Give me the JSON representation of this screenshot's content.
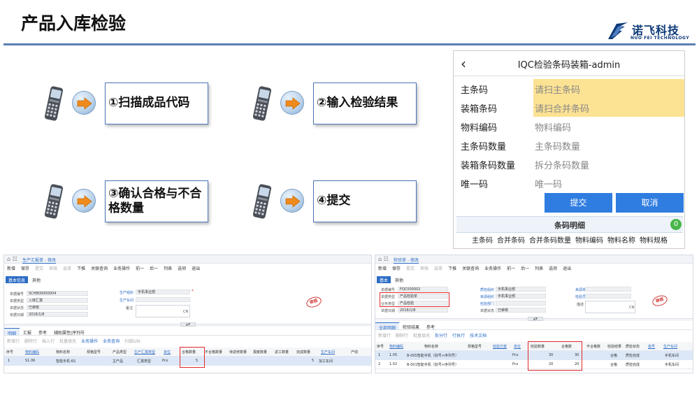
{
  "header": {
    "title": "产品入库检验",
    "logo_cn": "诺飞科技",
    "logo_en": "NUO FEI TECHNOLOGY",
    "brand_color": "#0d3a78"
  },
  "steps": [
    {
      "label": "①扫描成品代码"
    },
    {
      "label": "②输入检验结果"
    },
    {
      "label": "③确认合格与不合格数量"
    },
    {
      "label": "④提交"
    }
  ],
  "mobile": {
    "back_icon": "chevron-left-icon",
    "title": "IQC检验条码装箱-admin",
    "fields": [
      {
        "label": "主条码",
        "placeholder": "请扫主条码",
        "highlight": true
      },
      {
        "label": "装箱条码",
        "placeholder": "请扫合并条码",
        "highlight": true
      },
      {
        "label": "物料编码",
        "placeholder": "物料编码",
        "highlight": false
      },
      {
        "label": "主条码数量",
        "placeholder": "主条码数量",
        "highlight": false
      },
      {
        "label": "装箱条码数量",
        "placeholder": "拆分条码数量",
        "highlight": false
      },
      {
        "label": "唯一码",
        "placeholder": "唯一码",
        "highlight": false
      }
    ],
    "submit_label": "提交",
    "cancel_label": "取消",
    "detail_title": "条码明细",
    "detail_count": "0",
    "detail_columns": [
      "主条码",
      "合并条码",
      "合并条码数量",
      "物料编码",
      "物料名称",
      "物料规格"
    ]
  },
  "erp_left": {
    "tab_title": "生产汇报单 - 修改",
    "toolbar": [
      "新增",
      "保存",
      "提交",
      "审核",
      "选单",
      "下推",
      "关联查询",
      "业务操作",
      "前一",
      "后一",
      "列表",
      "选项",
      "退出"
    ],
    "subtabs": [
      "基本信息",
      "其他"
    ],
    "form": {
      "doc_no_label": "单据编号",
      "doc_no": "SCHB00000004",
      "doc_type_label": "单据类型",
      "doc_type": "入库汇报",
      "doc_status_label": "单据状态",
      "doc_status": "已审核",
      "doc_date_label": "单据日期",
      "doc_date": "2018/1/8",
      "org_label": "生产组织",
      "org": "手机事业部",
      "workshop_label": "生产车间",
      "workshop": "",
      "remark_label": "备注",
      "remark_lang": "CN",
      "stamp": "审核"
    },
    "detail_tabs": [
      "明细",
      "汇报",
      "参考",
      "辅助属性|序列号"
    ],
    "detail_tools": [
      "新增行",
      "删除行",
      "插入行",
      "批量填充",
      "业务操作",
      "业务查询",
      "扫描S/N"
    ],
    "columns": [
      "序号",
      "物料编码",
      "物料名称",
      "规格型号",
      "产品类型",
      "生产汇报类型",
      "单位",
      "合格数量",
      "不合格数量",
      "待返修数量",
      "报废数量",
      "返工数量",
      "完成数量",
      "生产车间",
      "产线"
    ],
    "rows": [
      {
        "seq": "1",
        "code": "S1.06",
        "name": "智能手机-6S",
        "spec": "",
        "ptype": "主产品",
        "rtype": "汇报类型",
        "unit": "Pcs",
        "qualified": "5",
        "unq": "",
        "repair": "",
        "scrap": "",
        "rework": "",
        "done": "5",
        "workshop": "加工车间",
        "line": ""
      }
    ]
  },
  "erp_right": {
    "tab_title": "检验单 - 修改",
    "toolbar": [
      "新增",
      "保存",
      "提交",
      "审核",
      "选单",
      "下推",
      "关联查询",
      "业务操作",
      "前一",
      "后一",
      "列表",
      "选项",
      "退出"
    ],
    "subtabs": [
      "基本",
      "其他"
    ],
    "form": {
      "doc_no_label": "单据编号",
      "doc_no": "FQC000002",
      "doc_type_label": "单据类型",
      "doc_type": "产品检验单",
      "biz_type_label": "业务类型",
      "biz_type": "产品检验",
      "doc_date_label": "单据日期",
      "doc_date": "2018/1/8",
      "qc_org_label": "质检组织",
      "qc_org": "手机事业部",
      "src_org_label": "来源组织",
      "src_org": "手机事业部",
      "qc_dept_label": "检验部门",
      "qc_dept": "",
      "doc_status_label": "单据状态",
      "doc_status": "已审核",
      "source_label": "来源单",
      "source": "",
      "inspector_label": "检验员",
      "inspector": "",
      "desc_label": "描述",
      "desc_lang": "CN",
      "stamp": "审核"
    },
    "detail_tabs": [
      "全部明细",
      "检验结果",
      "参考"
    ],
    "detail_tools": [
      "新增行",
      "删除行",
      "批量填充",
      "拆分行",
      "行执行",
      "技术文档"
    ],
    "columns": [
      "序号",
      "物料编码",
      "物料名称",
      "规格型号",
      "检验方案",
      "单位",
      "检验数量",
      "合格数",
      "不合格数",
      "检验结果",
      "质检状态",
      "批号",
      "生产车间"
    ],
    "rows": [
      {
        "seq": "1",
        "code": "1.05",
        "name": "B-005智能手机（批号+序列号）",
        "spec": "",
        "plan": "",
        "unit": "Pcs",
        "qty": "30",
        "ok": "30",
        "ng": "",
        "result": "合格",
        "status": "质检完成",
        "lot": "",
        "ws": "手机车间"
      },
      {
        "seq": "2",
        "code": "1.02",
        "name": "B-001智能手机（批号+序列号）",
        "spec": "",
        "plan": "",
        "unit": "Pcs",
        "qty": "20",
        "ok": "20",
        "ng": "",
        "result": "合格",
        "status": "质检完成",
        "lot": "",
        "ws": "手机车间"
      }
    ]
  },
  "colors": {
    "accent": "#2f7de1",
    "step_border": "#4a74b8",
    "field_highlight": "#fce293",
    "highlight_box": "#e22a2a"
  }
}
